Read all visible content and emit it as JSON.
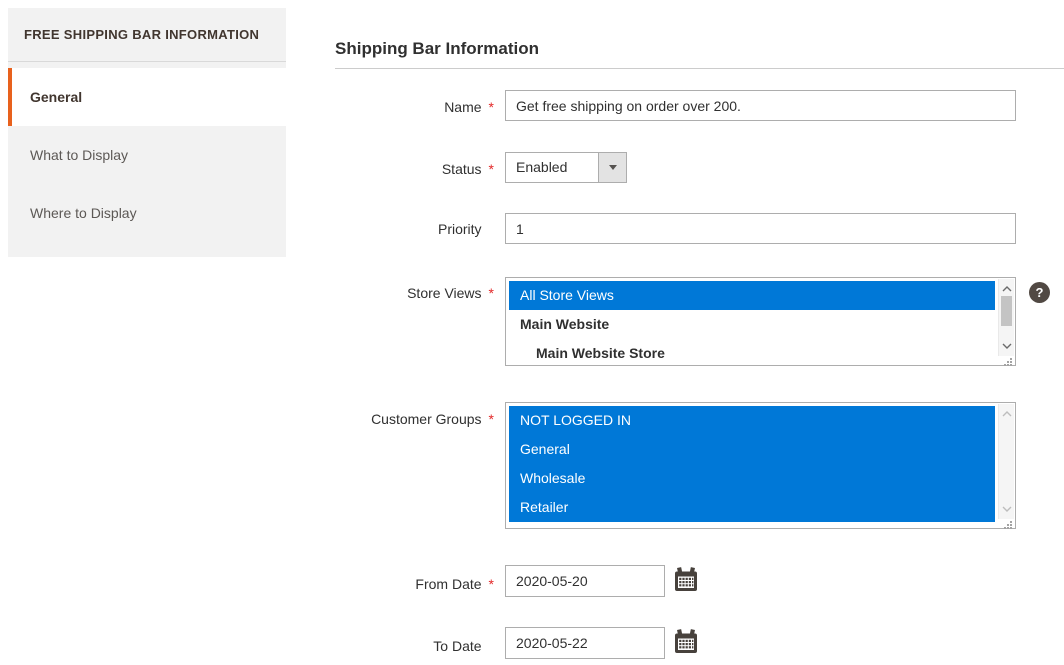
{
  "sidebar": {
    "header": "FREE SHIPPING BAR INFORMATION",
    "items": [
      {
        "label": "General"
      },
      {
        "label": "What to Display"
      },
      {
        "label": "Where to Display"
      }
    ]
  },
  "form": {
    "title": "Shipping Bar Information",
    "required_marker": "*",
    "name": {
      "label": "Name",
      "value": "Get free shipping on order over 200."
    },
    "status": {
      "label": "Status",
      "value": "Enabled"
    },
    "priority": {
      "label": "Priority",
      "value": "1"
    },
    "store_views": {
      "label": "Store Views",
      "help_glyph": "?",
      "options": [
        {
          "label": "All Store Views",
          "selected": true
        },
        {
          "label": "Main Website",
          "selected": false
        },
        {
          "label": "Main Website Store",
          "selected": false
        }
      ]
    },
    "customer_groups": {
      "label": "Customer Groups",
      "options": [
        {
          "label": "NOT LOGGED IN",
          "selected": true
        },
        {
          "label": "General",
          "selected": true
        },
        {
          "label": "Wholesale",
          "selected": true
        },
        {
          "label": "Retailer",
          "selected": true
        }
      ]
    },
    "from_date": {
      "label": "From Date",
      "value": "2020-05-20"
    },
    "to_date": {
      "label": "To Date",
      "value": "2020-05-22"
    }
  },
  "colors": {
    "accent_orange": "#e8611d",
    "selection_blue": "#0078d7",
    "required_red": "#e22626",
    "help_icon_bg": "#514943",
    "sidebar_bg": "#f2f2f2"
  }
}
